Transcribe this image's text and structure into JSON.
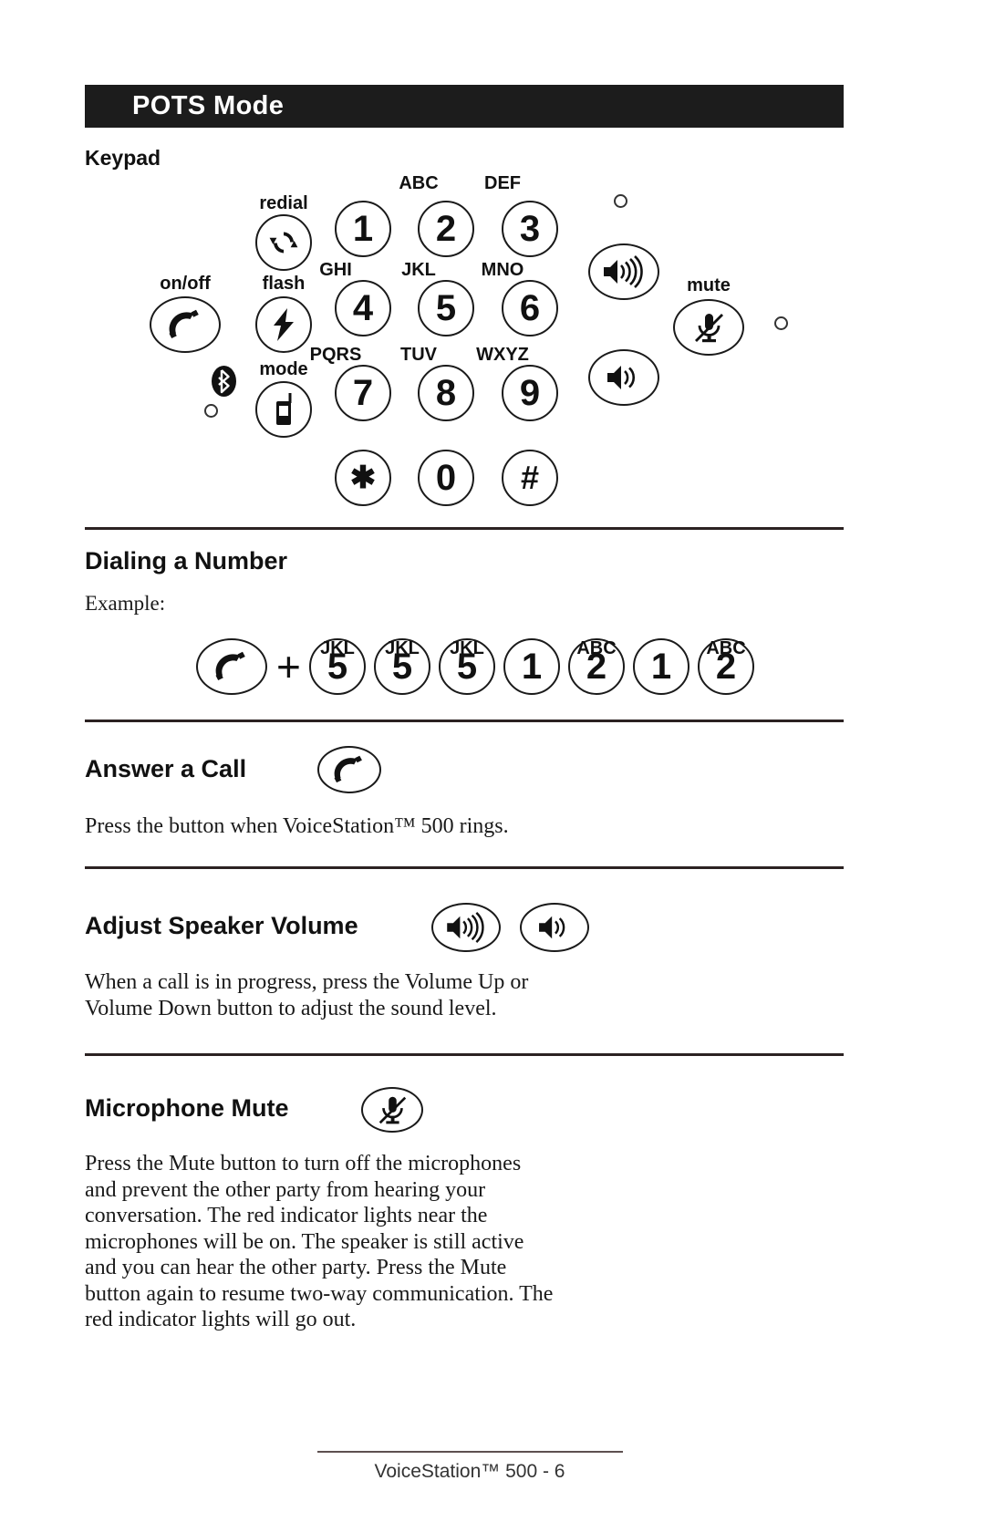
{
  "header": {
    "title": "POTS Mode"
  },
  "sections": {
    "keypad": {
      "heading": "Keypad",
      "function_keys": [
        {
          "label": "redial",
          "icon": "redial-icon"
        },
        {
          "label": "on/off",
          "icon": "phone-handset-icon"
        },
        {
          "label": "flash",
          "icon": "lightning-bolt-icon"
        },
        {
          "label": "mode",
          "icon": "mobile-phone-icon"
        },
        {
          "label": "mute",
          "icon": "microphone-mute-icon"
        }
      ],
      "bluetooth_icon": "bluetooth-icon",
      "number_keys": [
        {
          "digit": "1",
          "letters": ""
        },
        {
          "digit": "2",
          "letters": "ABC"
        },
        {
          "digit": "3",
          "letters": "DEF"
        },
        {
          "digit": "4",
          "letters": "GHI"
        },
        {
          "digit": "5",
          "letters": "JKL"
        },
        {
          "digit": "6",
          "letters": "MNO"
        },
        {
          "digit": "7",
          "letters": "PQRS"
        },
        {
          "digit": "8",
          "letters": "TUV"
        },
        {
          "digit": "9",
          "letters": "WXYZ"
        },
        {
          "digit": "✱",
          "letters": ""
        },
        {
          "digit": "0",
          "letters": ""
        },
        {
          "digit": "#",
          "letters": ""
        }
      ],
      "volume_up_icon": "volume-up-icon",
      "volume_down_icon": "volume-down-icon",
      "indicator_lights": [
        "led-indicator-top",
        "led-indicator-mute",
        "led-indicator-bluetooth"
      ]
    },
    "dialing": {
      "heading": "Dialing a Number",
      "example_label": "Example:",
      "sequence": [
        {
          "key": "phone-handset-icon",
          "letters": "",
          "type": "icon"
        },
        {
          "key": "+",
          "letters": "",
          "type": "operator"
        },
        {
          "key": "5",
          "letters": "JKL",
          "type": "digit"
        },
        {
          "key": "5",
          "letters": "JKL",
          "type": "digit"
        },
        {
          "key": "5",
          "letters": "JKL",
          "type": "digit"
        },
        {
          "key": "1",
          "letters": "",
          "type": "digit"
        },
        {
          "key": "2",
          "letters": "ABC",
          "type": "digit"
        },
        {
          "key": "1",
          "letters": "",
          "type": "digit"
        },
        {
          "key": "2",
          "letters": "ABC",
          "type": "digit"
        }
      ]
    },
    "answer": {
      "heading": "Answer a Call",
      "icon": "phone-handset-icon",
      "body": "Press the  button when VoiceStation™ 500 rings."
    },
    "volume": {
      "heading": "Adjust Speaker Volume",
      "up_icon": "volume-up-icon",
      "down_icon": "volume-down-icon",
      "body": "When a call is in progress, press the Volume Up or\nVolume Down button to adjust the sound level."
    },
    "mute": {
      "heading": "Microphone Mute",
      "icon": "microphone-mute-icon",
      "body": "Press the Mute button to turn off the microphones\nand prevent the other party from hearing your\nconversation.  The red indicator lights near the\nmicrophones will be on.  The speaker is still active\nand you can hear the other party.  Press the Mute\nbutton again to resume two-way communication.  The\nred indicator lights will go out."
    }
  },
  "footer": {
    "text": "VoiceStation™ 500 - 6"
  },
  "colors": {
    "title_bar_bg": "#1c1c1c",
    "title_text": "#ffffff",
    "ink": "#1a1a1a",
    "rule": "#2b2222",
    "footer_rule": "#5d5050"
  }
}
